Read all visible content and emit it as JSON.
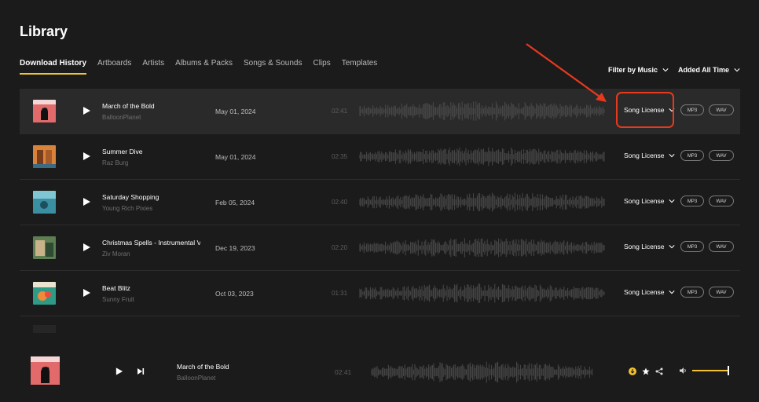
{
  "page": {
    "title": "Library"
  },
  "tabs": [
    {
      "label": "Download History"
    },
    {
      "label": "Artboards"
    },
    {
      "label": "Artists"
    },
    {
      "label": "Albums & Packs"
    },
    {
      "label": "Songs & Sounds"
    },
    {
      "label": "Clips"
    },
    {
      "label": "Templates"
    }
  ],
  "filters": {
    "type_label": "Filter by Music",
    "time_label": "Added All Time"
  },
  "tracks": [
    {
      "name": "March of the Bold",
      "artist": "BalloonPlanet",
      "date": "May 01, 2024",
      "duration": "02:41",
      "license": "Song License",
      "mp3": "MP3",
      "wav": "WAV",
      "cover": "red-fist"
    },
    {
      "name": "Summer Dive",
      "artist": "Raz Burg",
      "date": "May 01, 2024",
      "duration": "02:35",
      "license": "Song License",
      "mp3": "MP3",
      "wav": "WAV",
      "cover": "orange-doors"
    },
    {
      "name": "Saturday Shopping",
      "artist": "Young Rich Pixies",
      "date": "Feb 05, 2024",
      "duration": "02:40",
      "license": "Song License",
      "mp3": "MP3",
      "wav": "WAV",
      "cover": "teal-sea"
    },
    {
      "name": "Christmas Spells - Instrumental V",
      "artist": "Ziv Moran",
      "date": "Dec 19, 2023",
      "duration": "02:20",
      "license": "Song License",
      "mp3": "MP3",
      "wav": "WAV",
      "cover": "green-photo"
    },
    {
      "name": "Beat Blitz",
      "artist": "Sunny Fruit",
      "date": "Oct 03, 2023",
      "duration": "01:31",
      "license": "Song License",
      "mp3": "MP3",
      "wav": "WAV",
      "cover": "teal-fruit"
    }
  ],
  "player": {
    "name": "March of the Bold",
    "artist": "BalloonPlanet",
    "duration": "02:41",
    "volume": 1.0
  },
  "colors": {
    "accent": "#f2c230",
    "annotation": "#e8391e",
    "highlight_row": "#2a2a2a"
  },
  "icons": [
    "play-icon",
    "next-icon",
    "chevron-down-icon",
    "download-icon",
    "star-icon",
    "share-icon",
    "volume-icon"
  ]
}
